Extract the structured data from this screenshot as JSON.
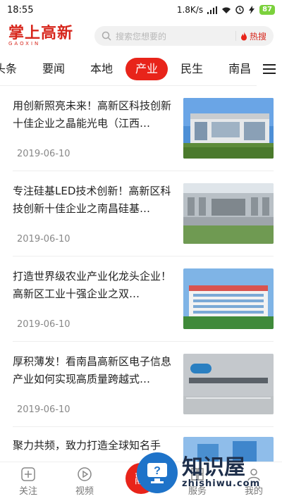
{
  "status_bar": {
    "time": "18:55",
    "network_speed": "1.8K/s",
    "battery": "87"
  },
  "header": {
    "logo_text": "掌上高新",
    "logo_sub": "GAOXIN",
    "search_placeholder": "搜索您想要的",
    "hot_search_label": "热搜"
  },
  "tabs": [
    {
      "label": "头条",
      "active": false
    },
    {
      "label": "要闻",
      "active": false
    },
    {
      "label": "本地",
      "active": false
    },
    {
      "label": "产业",
      "active": true
    },
    {
      "label": "民生",
      "active": false
    },
    {
      "label": "南昌",
      "active": false
    }
  ],
  "news": [
    {
      "title": "用创新照亮未来！高新区科技创新十佳企业之晶能光电（江西…",
      "date": "2019-06-10",
      "thumb": "glass-building"
    },
    {
      "title": "专注硅基LED技术创新！高新区科技创新十佳企业之南昌硅基…",
      "date": "2019-06-10",
      "thumb": "factory-gate"
    },
    {
      "title": "打造世界级农业产业化龙头企业！高新区工业十强企业之双…",
      "date": "2019-06-10",
      "thumb": "office-building"
    },
    {
      "title": "厚积薄发！看南昌高新区电子信息产业如何实现高质量跨越式…",
      "date": "2019-06-10",
      "thumb": "shineon-lobby"
    },
    {
      "title": "聚力共频，致力打造全球知名手",
      "date": "",
      "thumb": "blue-towers"
    }
  ],
  "bottom_nav": {
    "follow_label": "关注",
    "video_label": "视频",
    "center_label": "融",
    "service_label": "服务",
    "mine_label": "我的"
  },
  "watermark": {
    "cn": "知识屋",
    "en": "zhishiwu.com"
  }
}
